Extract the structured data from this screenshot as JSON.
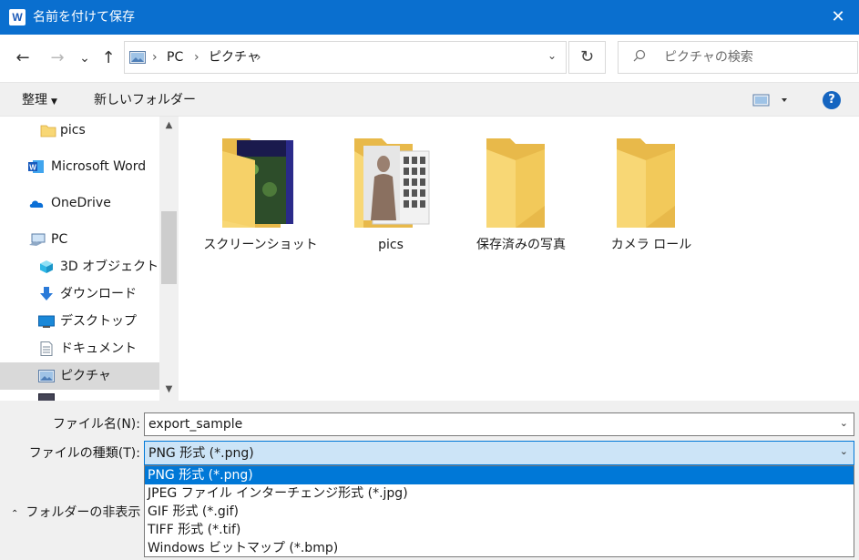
{
  "window": {
    "title": "名前を付けて保存",
    "app_icon_letter": "W",
    "close_glyph": "✕"
  },
  "nav": {
    "back_glyph": "←",
    "forward_glyph": "→",
    "recent_glyph": "⌄",
    "up_glyph": "↑",
    "breadcrumbs": [
      "PC",
      "ピクチャ"
    ],
    "sep_glyph": "›",
    "dropdown_glyph": "⌄",
    "refresh_glyph": "↻",
    "search_placeholder": "ピクチャの検索",
    "search_glyph": "⌕"
  },
  "toolbar": {
    "organize_label": "整理",
    "new_folder_label": "新しいフォルダー",
    "help_label": "?"
  },
  "sidebar": {
    "items": [
      {
        "label": "pics",
        "icon": "folder-icon"
      },
      {
        "label": "Microsoft Word",
        "icon": "word-icon"
      },
      {
        "label": "OneDrive",
        "icon": "cloud-icon"
      },
      {
        "label": "PC",
        "icon": "pc-icon"
      },
      {
        "label": "3D オブジェクト",
        "icon": "cube-icon"
      },
      {
        "label": "ダウンロード",
        "icon": "download-icon"
      },
      {
        "label": "デスクトップ",
        "icon": "desktop-icon"
      },
      {
        "label": "ドキュメント",
        "icon": "document-icon"
      },
      {
        "label": "ピクチャ",
        "icon": "pictures-icon",
        "selected": true
      }
    ],
    "scroll_up_glyph": "▲",
    "scroll_down_glyph": "▼"
  },
  "folders": [
    {
      "label": "スクリーンショット",
      "preview": "game-screenshot"
    },
    {
      "label": "pics",
      "preview": "photo-grid"
    },
    {
      "label": "保存済みの写真",
      "preview": "empty"
    },
    {
      "label": "カメラ ロール",
      "preview": "empty"
    }
  ],
  "form": {
    "filename_label": "ファイル名(N):",
    "filename_value": "export_sample",
    "filetype_label": "ファイルの種類(T):",
    "filetype_value": "PNG 形式 (*.png)",
    "hide_folders_label": "フォルダーの非表示",
    "hide_folders_glyph": "⌃",
    "dd_glyph": "⌄"
  },
  "filetype_options": [
    "PNG 形式 (*.png)",
    "JPEG ファイル インターチェンジ形式 (*.jpg)",
    "GIF 形式 (*.gif)",
    "TIFF 形式 (*.tif)",
    "Windows ビットマップ (*.bmp)"
  ],
  "colors": {
    "titlebar": "#0a6fcf",
    "selection": "#0078d7",
    "folder_yellow": "#f8d775",
    "folder_dark": "#e8b94a"
  }
}
